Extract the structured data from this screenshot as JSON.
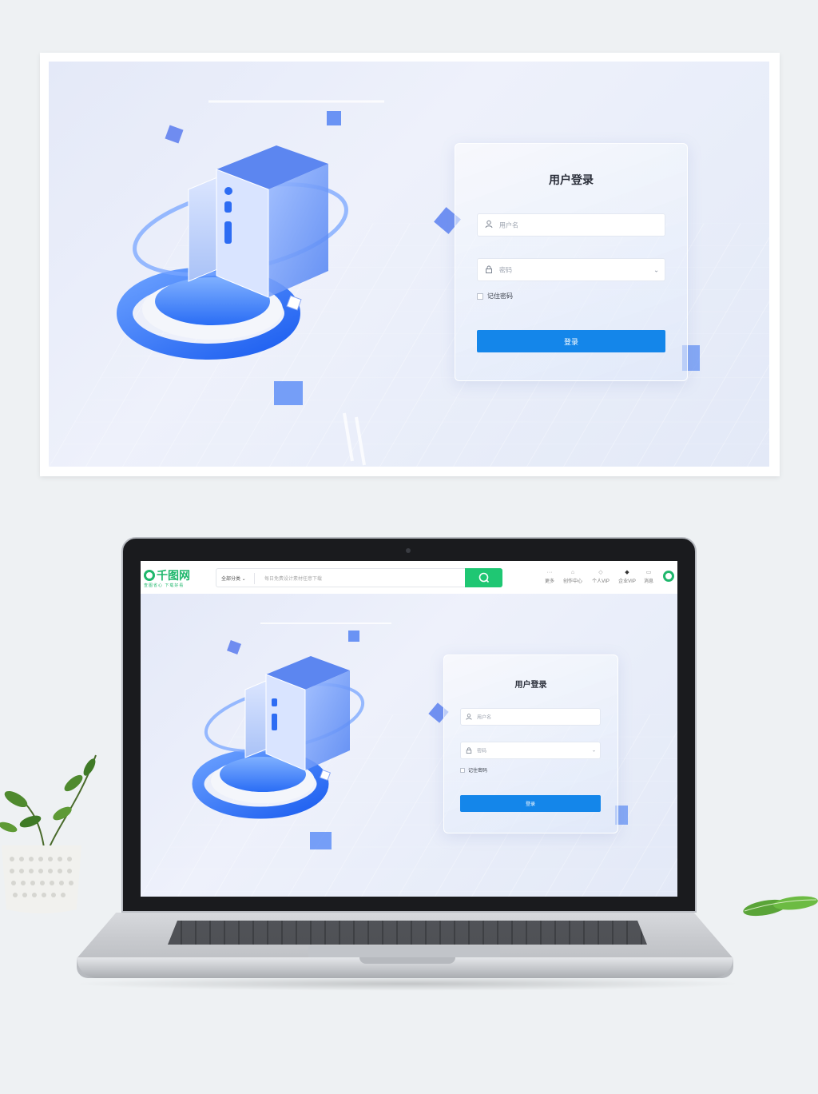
{
  "banner": {
    "login": {
      "title": "用户登录",
      "username_placeholder": "用户名",
      "password_placeholder": "密码",
      "remember_label": "记住密码",
      "submit_label": "登录"
    }
  },
  "site": {
    "logo_text": "千图网",
    "logo_tagline": "查图省心 下载好看",
    "search": {
      "category_label": "全部分类",
      "placeholder": "每日免费设计素材任意下载"
    },
    "nav": [
      {
        "label": "更多",
        "icon": "more-icon"
      },
      {
        "label": "创作中心",
        "icon": "home-icon"
      },
      {
        "label": "个人VIP",
        "icon": "diamond-icon"
      },
      {
        "label": "企业VIP",
        "icon": "diamond-filled-icon"
      },
      {
        "label": "消息",
        "icon": "message-icon"
      }
    ]
  },
  "screen_login": {
    "title": "用户登录",
    "username_placeholder": "用户名",
    "password_placeholder": "密码",
    "remember_label": "记住密码",
    "submit_label": "登录"
  },
  "colors": {
    "accent": "#1486ea",
    "brand": "#1fb76c",
    "background": "#eef1f3"
  }
}
